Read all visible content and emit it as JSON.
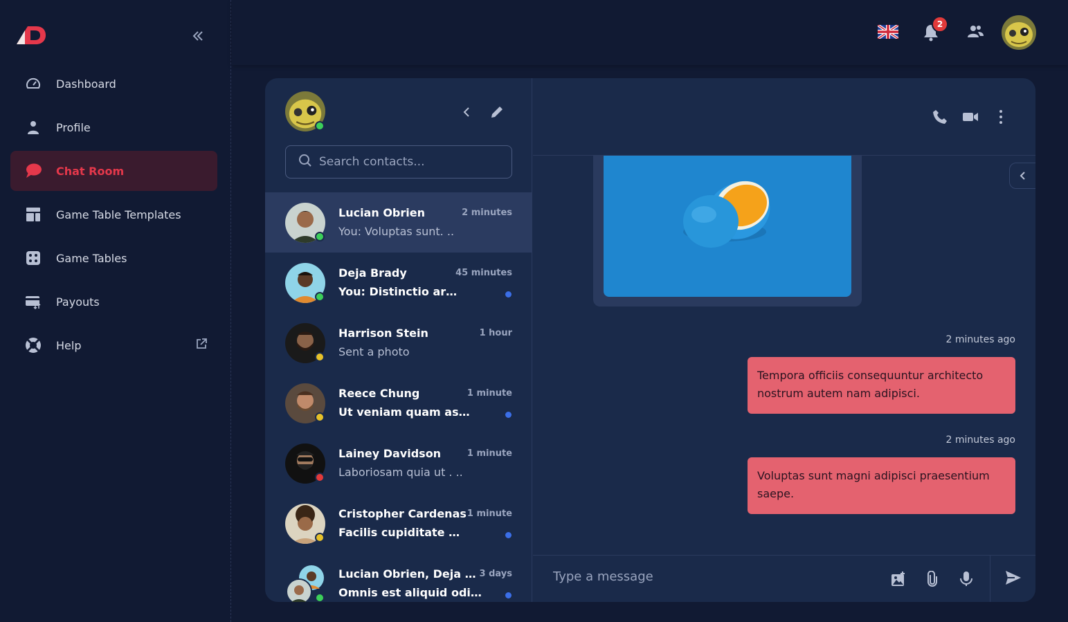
{
  "sidebar": {
    "logo_icon": "brand-logo-icon",
    "collapse_icon": "double-chevron-left-icon",
    "items": [
      {
        "label": "Dashboard",
        "icon": "gauge-icon"
      },
      {
        "label": "Profile",
        "icon": "user-icon"
      },
      {
        "label": "Chat Room",
        "icon": "chat-bubble-icon",
        "active": true
      },
      {
        "label": "Game Table Templates",
        "icon": "layout-template-icon"
      },
      {
        "label": "Game Tables",
        "icon": "dice-icon"
      },
      {
        "label": "Payouts",
        "icon": "card-transfer-icon"
      },
      {
        "label": "Help",
        "icon": "lifebuoy-icon",
        "external": true
      }
    ]
  },
  "topbar": {
    "language_icon": "uk-flag-icon",
    "notifications_count": "2",
    "contacts_icon": "people-icon"
  },
  "contacts_panel": {
    "search_placeholder": "Search contacts...",
    "contacts": [
      {
        "name": "Lucian Obrien",
        "time": "2 minutes",
        "message": "You: Voluptas sunt. ..",
        "status": "online",
        "unread": false,
        "selected": true
      },
      {
        "name": "Deja Brady",
        "time": "45 minutes",
        "message": "You: Distinctio ar…",
        "status": "online",
        "unread": true
      },
      {
        "name": "Harrison Stein",
        "time": "1 hour",
        "message": "Sent a photo",
        "status": "away",
        "unread": false
      },
      {
        "name": "Reece Chung",
        "time": "1 minute",
        "message": "Ut veniam quam as…",
        "status": "away",
        "unread": true
      },
      {
        "name": "Lainey Davidson",
        "time": "1 minute",
        "message": "Laboriosam quia ut . ..",
        "status": "busy",
        "unread": false
      },
      {
        "name": "Cristopher Cardenas",
        "time": "1 minute",
        "message": "Facilis cupiditate …",
        "status": "away",
        "unread": true
      },
      {
        "name": "Lucian Obrien, Deja …",
        "time": "3 days",
        "message": "Omnis est aliquid odi…",
        "status": "online",
        "unread": true
      }
    ]
  },
  "chat": {
    "messages": [
      {
        "stamp": "2 minutes ago",
        "text": "Tempora officiis consequuntur architecto nostrum autem nam adipisci."
      },
      {
        "stamp": "2 minutes ago",
        "text": "Voluptas sunt magni adipisci praesentium saepe."
      }
    ],
    "composer_placeholder": "Type a message"
  },
  "colors": {
    "background": "#111a33",
    "card": "#1a2a4a",
    "accent_red": "#e5384b",
    "bubble": "#e4626f",
    "online": "#3ccf5a",
    "away": "#e6c12a",
    "busy": "#e23a3a",
    "unread_dot": "#3b6ee6"
  }
}
